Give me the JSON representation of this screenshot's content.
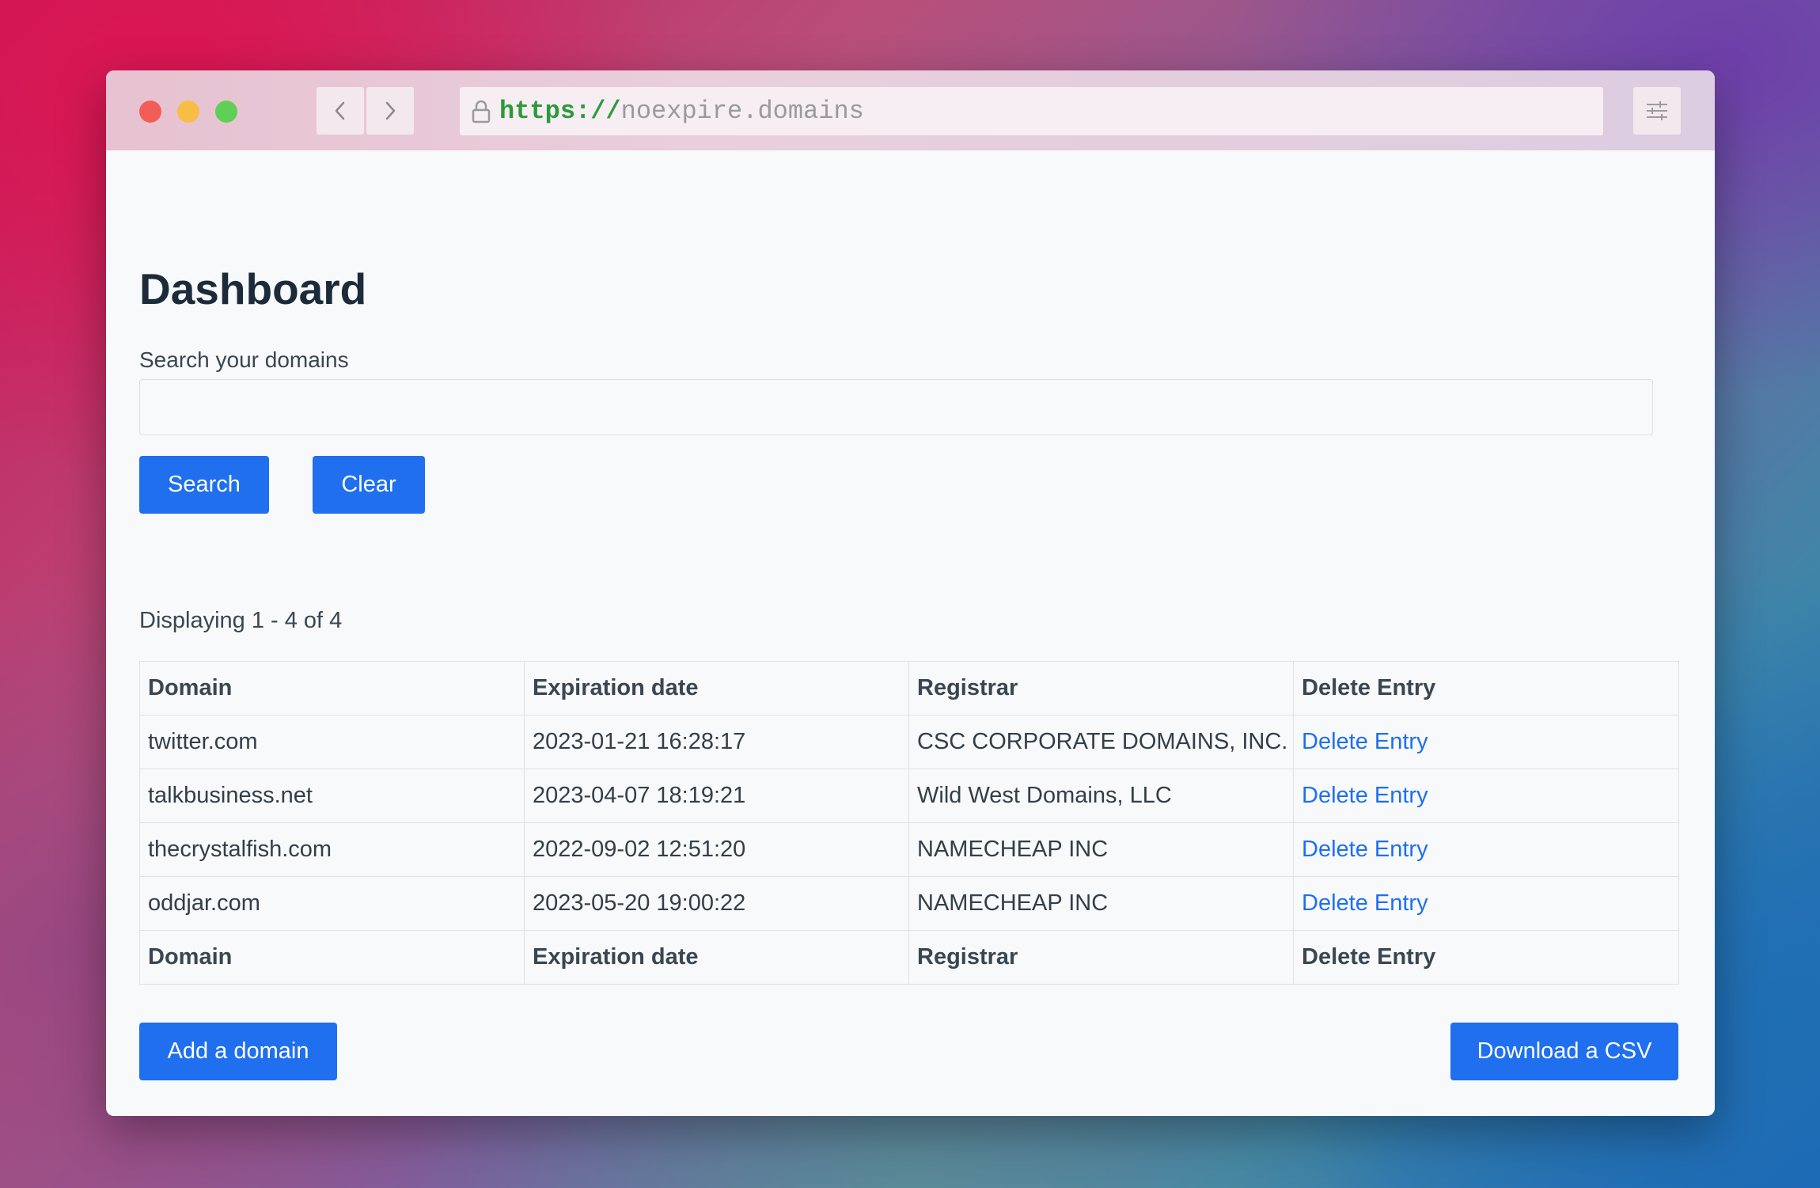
{
  "browser": {
    "url_scheme": "https://",
    "url_host": "noexpire.domains"
  },
  "page": {
    "title": "Dashboard"
  },
  "search": {
    "label": "Search your domains",
    "value": "",
    "placeholder": "",
    "search_button": "Search",
    "clear_button": "Clear"
  },
  "results": {
    "count_text": "Displaying 1 - 4 of 4"
  },
  "table": {
    "headers": [
      "Domain",
      "Expiration date",
      "Registrar",
      "Delete Entry"
    ],
    "rows": [
      {
        "domain": "twitter.com",
        "expiration": "2023-01-21 16:28:17",
        "registrar": "CSC CORPORATE DOMAINS, INC.",
        "action": "Delete Entry"
      },
      {
        "domain": "talkbusiness.net",
        "expiration": "2023-04-07 18:19:21",
        "registrar": "Wild West Domains, LLC",
        "action": "Delete Entry"
      },
      {
        "domain": "thecrystalfish.com",
        "expiration": "2022-09-02 12:51:20",
        "registrar": "NAMECHEAP INC",
        "action": "Delete Entry"
      },
      {
        "domain": "oddjar.com",
        "expiration": "2023-05-20 19:00:22",
        "registrar": "NAMECHEAP INC",
        "action": "Delete Entry"
      }
    ],
    "footers": [
      "Domain",
      "Expiration date",
      "Registrar",
      "Delete Entry"
    ]
  },
  "actions": {
    "add_domain": "Add a domain",
    "download_csv": "Download a CSV"
  },
  "colors": {
    "primary": "#1f6fef",
    "link": "#1f6fef",
    "heading": "#1c2b3a",
    "url_scheme": "#2d9a3a"
  },
  "icons": [
    "lock-icon",
    "chevron-left-icon",
    "chevron-right-icon",
    "sliders-icon"
  ]
}
